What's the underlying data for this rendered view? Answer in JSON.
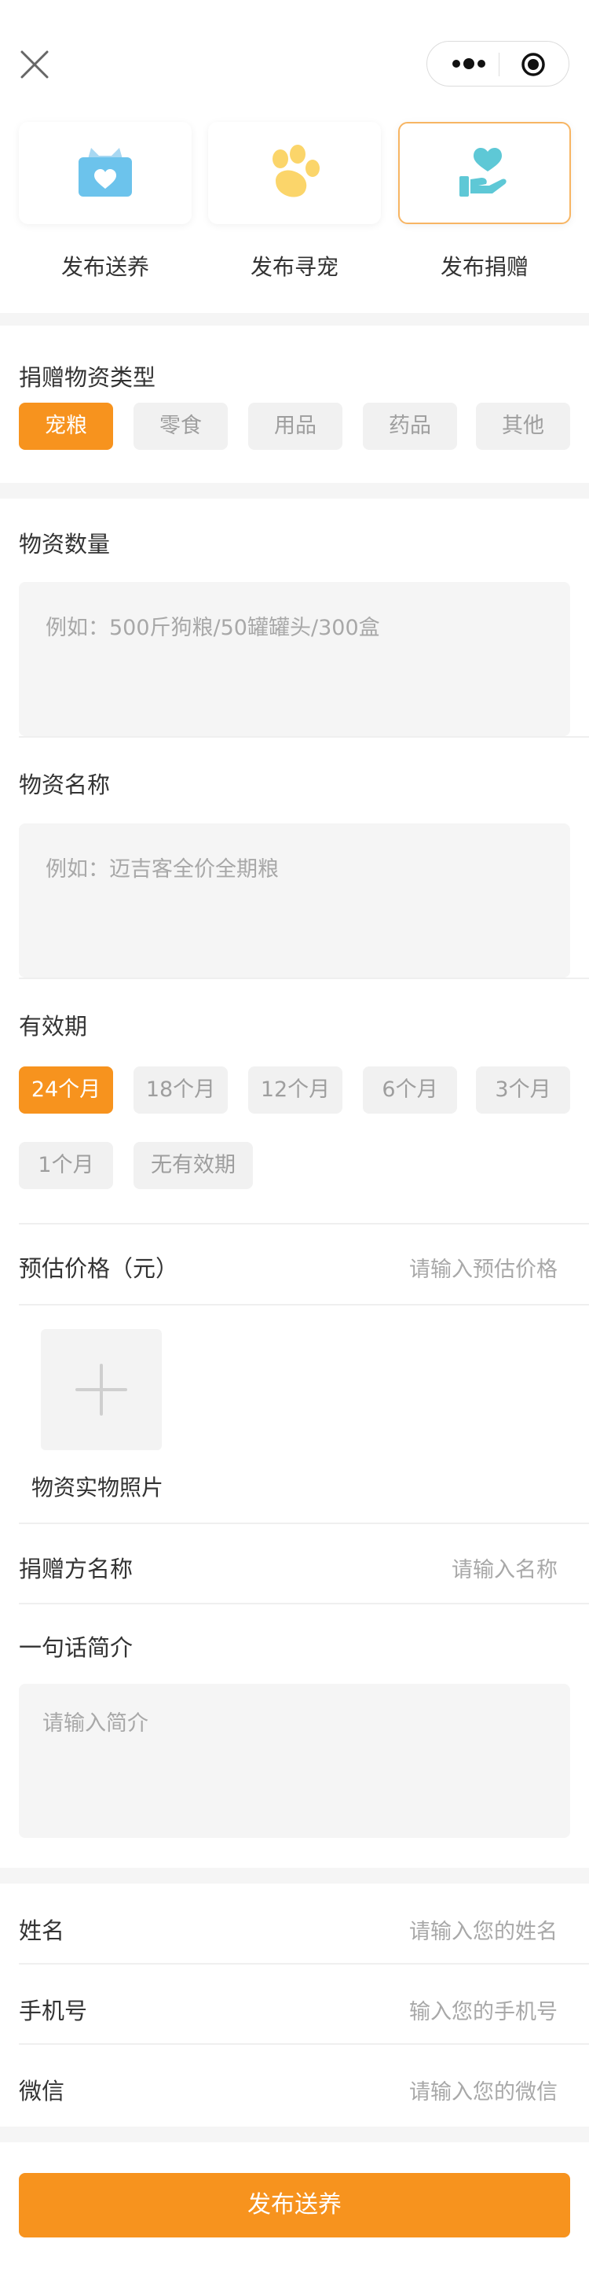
{
  "capsule": {
    "more_icon": "more-dots-icon",
    "record_icon": "record-icon"
  },
  "tabs": [
    {
      "label": "发布送养",
      "icon": "cat-heart-icon"
    },
    {
      "label": "发布寻宠",
      "icon": "paw-icon"
    },
    {
      "label": "发布捐赠",
      "icon": "hand-heart-icon",
      "active": true
    }
  ],
  "donation_type": {
    "title": "捐赠物资类型",
    "options": [
      "宠粮",
      "零食",
      "用品",
      "药品",
      "其他"
    ],
    "selected": "宠粮"
  },
  "quantity": {
    "title": "物资数量",
    "placeholder": "例如：500斤狗粮/50罐罐头/300盒"
  },
  "name": {
    "title": "物资名称",
    "placeholder": "例如：迈吉客全价全期粮"
  },
  "validity": {
    "title": "有效期",
    "options": [
      "24个月",
      "18个月",
      "12个月",
      "6个月",
      "3个月",
      "1个月",
      "无有效期"
    ],
    "selected": "24个月"
  },
  "price": {
    "label": "预估价格（元）",
    "placeholder": "请输入预估价格"
  },
  "photo": {
    "label": "物资实物照片",
    "add_icon": "plus-icon"
  },
  "donor": {
    "label": "捐赠方名称",
    "placeholder": "请输入名称"
  },
  "intro": {
    "title": "一句话简介",
    "placeholder": "请输入简介"
  },
  "contact": {
    "name_label": "姓名",
    "name_placeholder": "请输入您的姓名",
    "phone_label": "手机号",
    "phone_placeholder": "输入您的手机号",
    "wechat_label": "微信",
    "wechat_placeholder": "请输入您的微信"
  },
  "submit_label": "发布送养",
  "colors": {
    "accent": "#f7931e",
    "chip_bg": "#f1f1f1",
    "divider": "#f5f5f5",
    "placeholder": "#a8a8a8"
  }
}
